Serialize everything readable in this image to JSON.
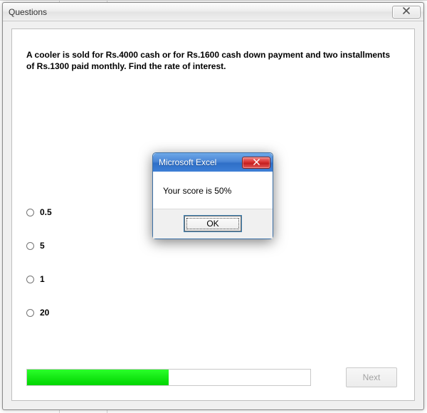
{
  "window": {
    "title": "Questions"
  },
  "question": {
    "text": "A cooler is sold for Rs.4000 cash or for Rs.1600 cash down payment and two installments of  Rs.1300 paid monthly. Find the rate of interest."
  },
  "options": [
    {
      "label": "0.5"
    },
    {
      "label": "5"
    },
    {
      "label": "1"
    },
    {
      "label": "20"
    }
  ],
  "progress": {
    "percent": 50
  },
  "next_button": {
    "label": "Next",
    "enabled": false
  },
  "msgbox": {
    "title": "Microsoft Excel",
    "body": "Your score is 50%",
    "ok_label": "OK"
  }
}
